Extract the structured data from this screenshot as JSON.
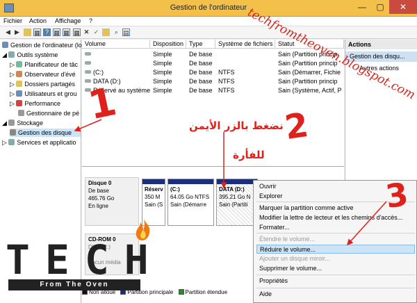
{
  "window": {
    "title": "Gestion de l'ordinateur",
    "min": "—",
    "max": "▢",
    "close": "✕"
  },
  "menu": {
    "items": [
      "Fichier",
      "Action",
      "Affichage",
      "?"
    ]
  },
  "toolbar": {
    "icons": [
      "back-icon",
      "forward-icon",
      "up-icon",
      "grid-icon",
      "help-icon",
      "grid2-icon",
      "cross-icon",
      "check-icon",
      "folder-icon",
      "search-icon",
      "magnify-icon",
      "grid3-icon"
    ]
  },
  "tree": {
    "root": "Gestion de l'ordinateur (local",
    "items": [
      {
        "label": "Outils système"
      },
      {
        "label": "Planificateur de tâc"
      },
      {
        "label": "Observateur d'évé"
      },
      {
        "label": "Dossiers partagés"
      },
      {
        "label": "Utilisateurs et grou"
      },
      {
        "label": "Performance"
      },
      {
        "label": "Gestionnaire de pé"
      },
      {
        "label": "Stockage"
      },
      {
        "label": "Gestion des disque"
      },
      {
        "label": "Services et applicatio"
      }
    ]
  },
  "volumes": {
    "headers": [
      "Volume",
      "Disposition",
      "Type",
      "Système de fichiers",
      "Statut"
    ],
    "rows": [
      [
        "",
        "Simple",
        "De base",
        "",
        "Sain (Partition princip"
      ],
      [
        "",
        "Simple",
        "De base",
        "",
        "Sain (Partition princip"
      ],
      [
        "(C:)",
        "Simple",
        "De base",
        "NTFS",
        "Sain (Démarrer, Fichie"
      ],
      [
        "DATA (D:)",
        "Simple",
        "De base",
        "NTFS",
        "Sain (Partition princip"
      ],
      [
        "Réservé au système",
        "Simple",
        "De base",
        "NTFS",
        "Sain (Système, Actif, P"
      ]
    ]
  },
  "disks": {
    "disk0": {
      "name": "Disque 0",
      "type": "De base",
      "size": "465.76 Go",
      "status": "En ligne"
    },
    "parts": [
      {
        "name": "Réserv",
        "size": "350 M",
        "status": "Sain (S"
      },
      {
        "name": "(C:)",
        "size": "64.05 Go NTFS",
        "status": "Sain (Démarre"
      },
      {
        "name": "DATA  (D:)",
        "size": "395.21 Go N",
        "status": "Sain (Partiti"
      }
    ],
    "cdrom": {
      "name": "CD-ROM 0",
      "l1": "DVD (E:)",
      "l2": "Aucun média"
    }
  },
  "legend": [
    "Non alloué",
    "Partition principale",
    "Partition étendue"
  ],
  "actions": {
    "header": "Actions",
    "item": "Gestion des disqu...",
    "sub": "Autres actions"
  },
  "context_menu": {
    "items": [
      {
        "label": "Ouvrir",
        "enabled": true
      },
      {
        "label": "Explorer",
        "enabled": true
      },
      {
        "label": "Marquer la partition comme active",
        "enabled": true
      },
      {
        "label": "Modifier la lettre de lecteur et les chemins d'accès...",
        "enabled": true
      },
      {
        "label": "Formater...",
        "enabled": true
      },
      {
        "label": "Étendre le volume...",
        "enabled": false
      },
      {
        "label": "Réduire le volume...",
        "enabled": true
      },
      {
        "label": "Ajouter un disque miroir...",
        "enabled": false
      },
      {
        "label": "Supprimer le volume...",
        "enabled": true
      },
      {
        "label": "Propriétés",
        "enabled": true
      },
      {
        "label": "Aide",
        "enabled": true
      }
    ]
  },
  "annotations": {
    "n1": "1",
    "n2": "2",
    "n3": "3",
    "arabic_line1": "نضغط بالزر الأيمن",
    "arabic_line2": "للفأرة",
    "watermark": "techfromtheoven.blogspot.com"
  },
  "logo": {
    "letters": "TECH",
    "sub": "From The Oven"
  },
  "colors": {
    "title_bar": "#f3c04a",
    "annotation": "#e0201a",
    "partition_bar": "#1b2e7a",
    "highlight": "#cde3f6"
  }
}
